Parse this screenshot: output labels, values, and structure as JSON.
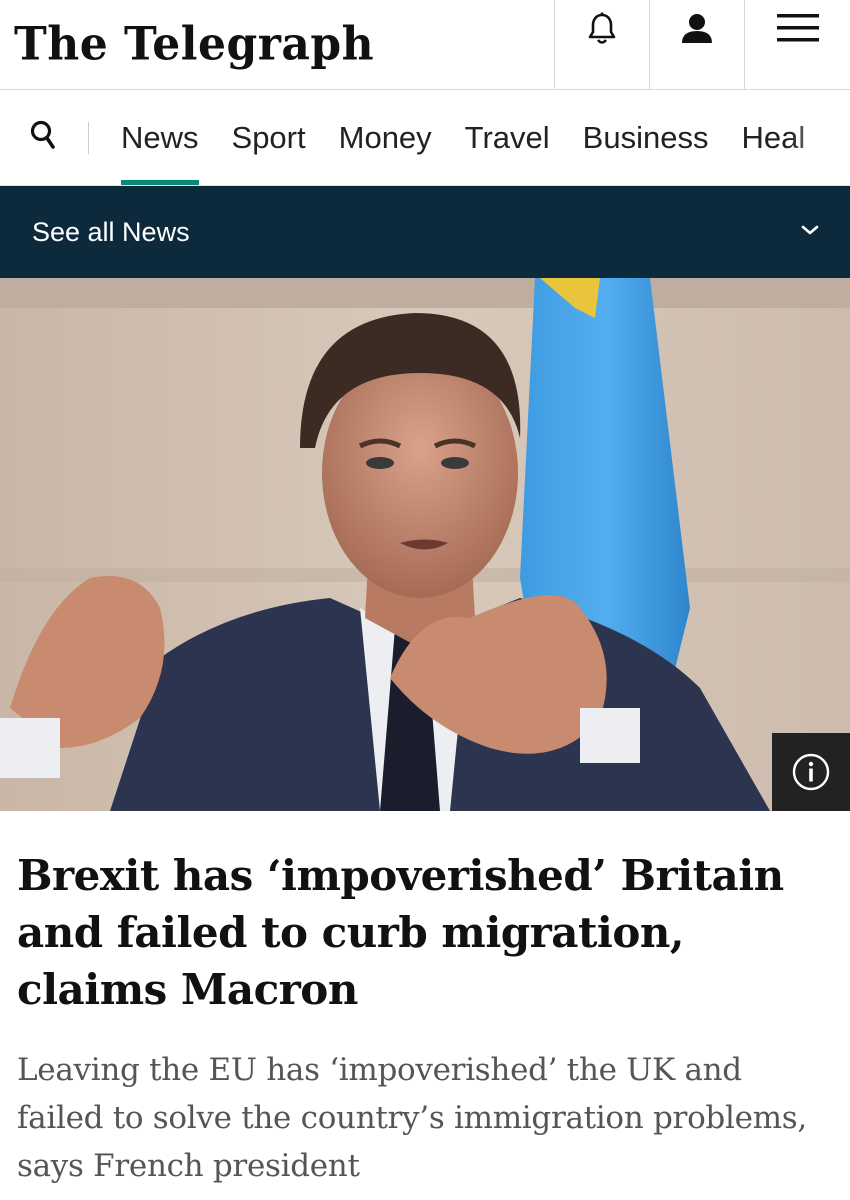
{
  "header": {
    "logo_text": "The Telegraph",
    "icons": [
      "bell-icon",
      "user-icon",
      "hamburger-menu-icon"
    ]
  },
  "nav": {
    "search_icon": "search-icon",
    "items": [
      {
        "label": "News",
        "active": true
      },
      {
        "label": "Sport",
        "active": false
      },
      {
        "label": "Money",
        "active": false
      },
      {
        "label": "Travel",
        "active": false
      },
      {
        "label": "Business",
        "active": false
      },
      {
        "label": "Heal",
        "active": false
      }
    ],
    "accent_color": "#0a8770"
  },
  "section_bar": {
    "label": "See all News",
    "icon": "chevron-down-icon",
    "background": "#0d2a3c"
  },
  "hero": {
    "info_icon": "info-icon"
  },
  "article": {
    "headline": "Brexit has ‘impoverished’ Britain and failed to curb migration, claims Macron",
    "standfirst": "Leaving the EU has ‘impoverished’ the UK and failed to solve the country’s immigration problems, says French president"
  }
}
